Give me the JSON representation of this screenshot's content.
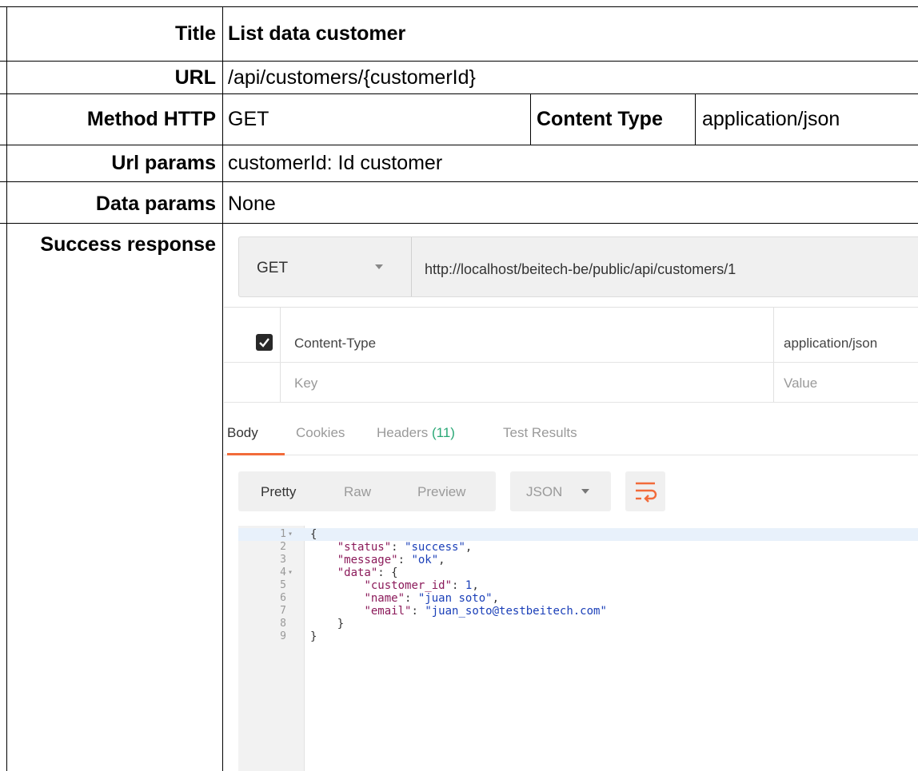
{
  "rows": {
    "title": {
      "label": "Title",
      "value": "List data customer"
    },
    "url": {
      "label": "URL",
      "value": "/api/customers/{customerId}"
    },
    "method": {
      "label": "Method HTTP",
      "value": "GET",
      "content_type_label": "Content Type",
      "content_type_value": "application/json"
    },
    "url_params": {
      "label": "Url params",
      "value": "customerId: Id customer"
    },
    "data_params": {
      "label": "Data params",
      "value": "None"
    },
    "success": {
      "label": "Success response"
    }
  },
  "postman": {
    "method": "GET",
    "url": "http://localhost/beitech-be/public/api/customers/1",
    "headers": [
      {
        "key": "Content-Type",
        "value": "application/json",
        "checked": true
      },
      {
        "key": "Key",
        "value": "Value",
        "placeholder": true
      }
    ],
    "tabs": {
      "body": "Body",
      "cookies": "Cookies",
      "headers": "Headers",
      "headers_count": "(11)",
      "test_results": "Test Results"
    },
    "format": {
      "pretty": "Pretty",
      "raw": "Raw",
      "preview": "Preview",
      "type": "JSON"
    },
    "code_lines": [
      {
        "n": "1",
        "text": "{"
      },
      {
        "n": "2",
        "text": "    \"status\": \"success\","
      },
      {
        "n": "3",
        "text": "    \"message\": \"ok\","
      },
      {
        "n": "4",
        "text": "    \"data\": {"
      },
      {
        "n": "5",
        "text": "        \"customer_id\": 1,"
      },
      {
        "n": "6",
        "text": "        \"name\": \"juan soto\","
      },
      {
        "n": "7",
        "text": "        \"email\": \"juan_soto@testbeitech.com\""
      },
      {
        "n": "8",
        "text": "    }"
      },
      {
        "n": "9",
        "text": "}"
      }
    ],
    "icons": {
      "checkbox": "check-icon",
      "wrap": "wrap-lines-icon",
      "dropdown": "chevron-down-icon"
    },
    "colors": {
      "accent": "#f26b3a",
      "count": "#2aa876",
      "json_key": "#8b1a5a",
      "json_value": "#1a3fb8"
    }
  }
}
